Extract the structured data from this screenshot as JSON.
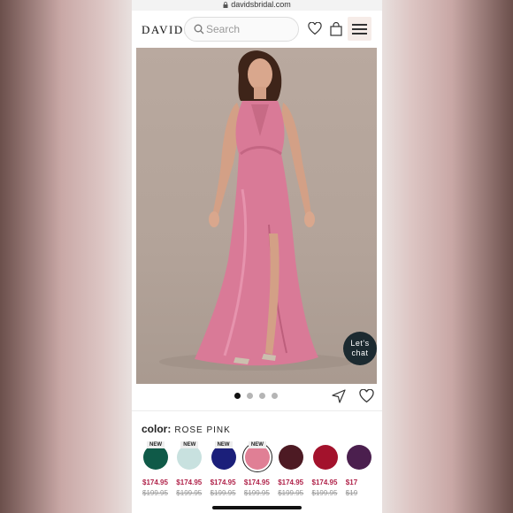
{
  "browser": {
    "url": "davidsbridal.com"
  },
  "header": {
    "logo": "DAVIDS",
    "search_placeholder": "Search"
  },
  "hero": {
    "chat_line1": "Let's",
    "chat_line2": "chat",
    "carousel_count": 4,
    "carousel_active": 1
  },
  "product": {
    "color_label": "color:",
    "color_value": "ROSE PINK",
    "swatches": [
      {
        "color": "#0f5a48",
        "is_new": true,
        "new_label": "NEW",
        "price": "$174.95",
        "old_price": "$199.95"
      },
      {
        "color": "#c8e1df",
        "is_new": true,
        "new_label": "NEW",
        "price": "$174.95",
        "old_price": "$199.95"
      },
      {
        "color": "#1b1f7a",
        "is_new": true,
        "new_label": "NEW",
        "price": "$174.95",
        "old_price": "$199.95"
      },
      {
        "color": "#e07f95",
        "is_new": true,
        "new_label": "NEW",
        "price": "$174.95",
        "old_price": "$199.95",
        "selected": true
      },
      {
        "color": "#4d1a23",
        "is_new": false,
        "price": "$174.95",
        "old_price": "$199.95"
      },
      {
        "color": "#a3122c",
        "is_new": false,
        "price": "$174.95",
        "old_price": "$199.95"
      },
      {
        "color": "#4b1f4e",
        "is_new": false,
        "price": "$17",
        "old_price": "$19"
      }
    ]
  },
  "colors": {
    "price": "#b0234a",
    "dress": "#d97a97"
  }
}
